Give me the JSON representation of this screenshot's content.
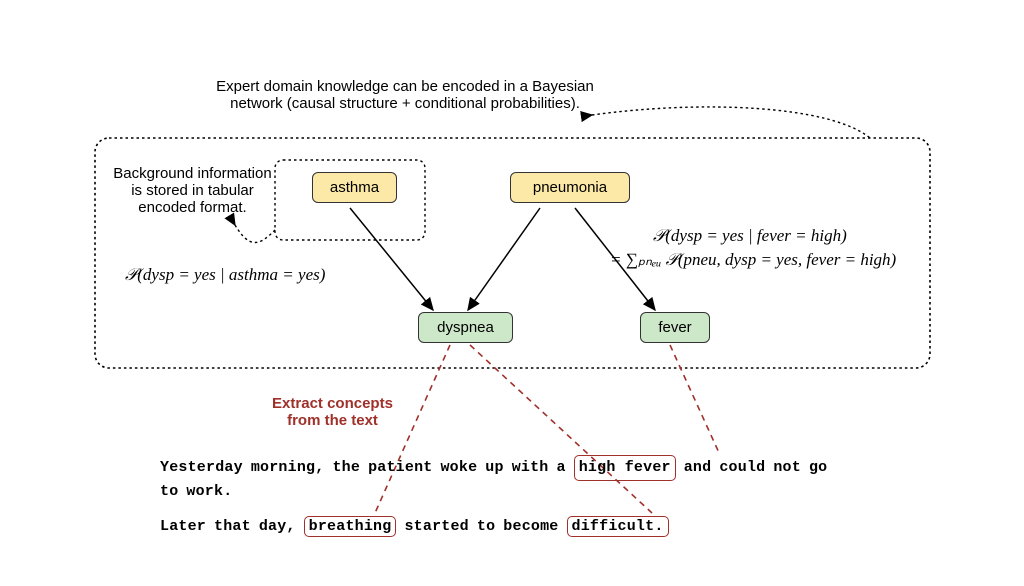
{
  "caption_top": "Expert domain knowledge can be encoded in a Bayesian network (causal structure + conditional probabilities).",
  "caption_bg": "Background information is stored in tabular encoded format.",
  "nodes": {
    "asthma": "asthma",
    "pneumonia": "pneumonia",
    "dyspnea": "dyspnea",
    "fever": "fever"
  },
  "math": {
    "left": "𝒫(dysp = yes | asthma = yes)",
    "right1": "𝒫(dysp = yes | fever = high)",
    "right2": "= ∑ₚₙₑᵤ 𝒫(pneu, dysp = yes, fever = high)"
  },
  "extract_label": "Extract concepts from the text",
  "sentence1_words": [
    {
      "t": "Yesterday"
    },
    {
      "t": "morning,"
    },
    {
      "t": "the"
    },
    {
      "t": "patient"
    },
    {
      "t": "woke"
    },
    {
      "t": "up"
    },
    {
      "t": "with"
    },
    {
      "t": "a"
    },
    {
      "t": "high",
      "hl": true,
      "group": "hf"
    },
    {
      "t": "fever",
      "hl": true,
      "group": "hf"
    },
    {
      "t": "and"
    },
    {
      "t": "could"
    },
    {
      "t": "not"
    },
    {
      "t": "go"
    },
    {
      "t": "to"
    },
    {
      "t": "work."
    }
  ],
  "sentence2_words": [
    {
      "t": "Later"
    },
    {
      "t": "that"
    },
    {
      "t": "day,"
    },
    {
      "t": "breathing",
      "hl": true
    },
    {
      "t": "started"
    },
    {
      "t": "to"
    },
    {
      "t": "become"
    },
    {
      "t": "difficult.",
      "hl": true
    }
  ]
}
